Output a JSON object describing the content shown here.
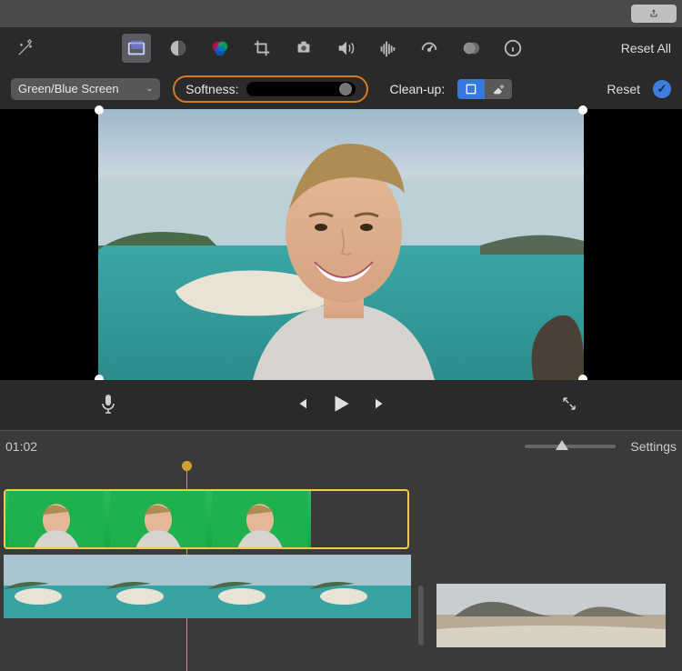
{
  "titlebar": {
    "share_icon": "share-icon"
  },
  "toolbar": {
    "tools": [
      {
        "name": "video-overlay-icon",
        "active": true
      },
      {
        "name": "color-balance-icon"
      },
      {
        "name": "color-correction-icon"
      },
      {
        "name": "crop-icon"
      },
      {
        "name": "stabilization-icon"
      },
      {
        "name": "volume-icon"
      },
      {
        "name": "noise-reduction-icon"
      },
      {
        "name": "speed-icon"
      },
      {
        "name": "clip-filter-icon"
      },
      {
        "name": "info-icon"
      }
    ],
    "reset_all": "Reset All"
  },
  "controls": {
    "dropdown_value": "Green/Blue Screen",
    "softness_label": "Softness:",
    "cleanup_label": "Clean-up:",
    "reset": "Reset"
  },
  "playback": {
    "timecode": "01:02",
    "settings": "Settings"
  }
}
